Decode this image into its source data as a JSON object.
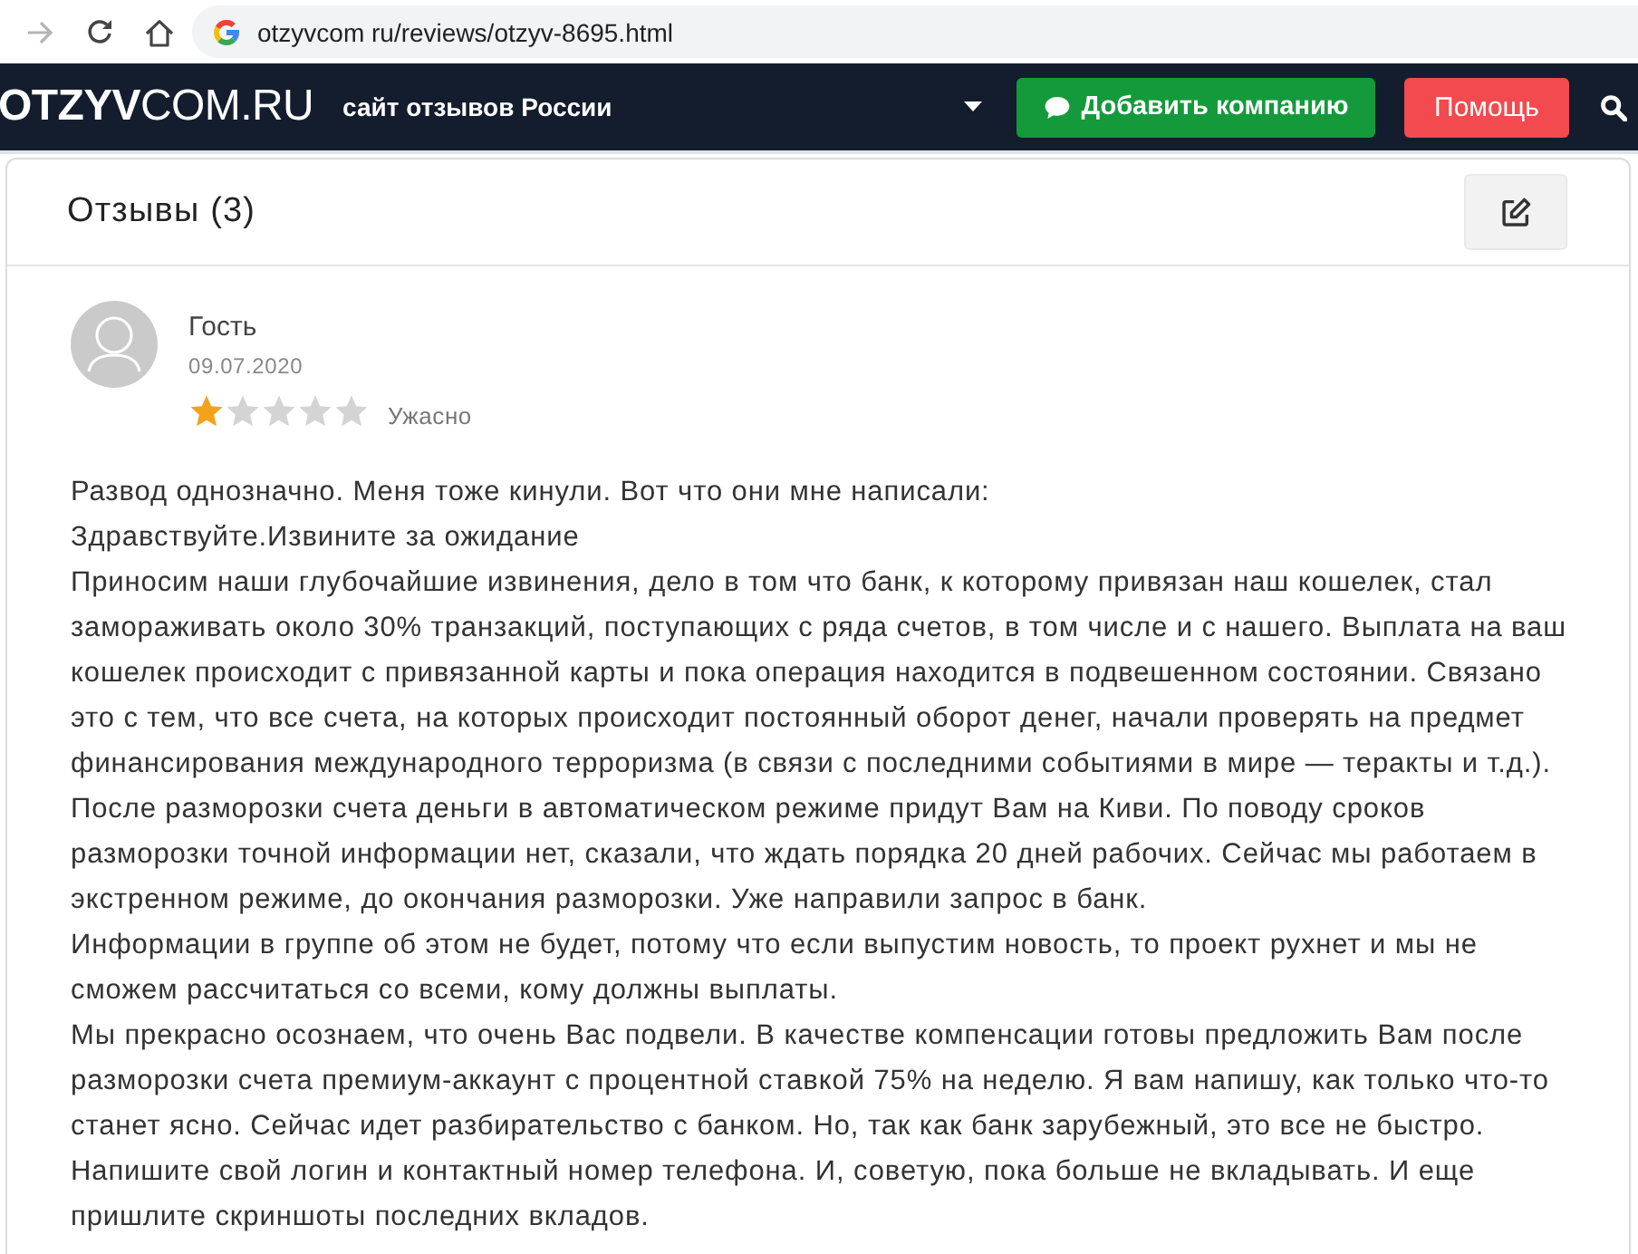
{
  "browser": {
    "nav_buttons": [
      {
        "kind": "forward",
        "disabled": true
      },
      {
        "kind": "reload",
        "disabled": false
      },
      {
        "kind": "home",
        "disabled": false
      }
    ],
    "url": "otzyvcom ru/reviews/otzyv-8695.html"
  },
  "site_header": {
    "logo": "**OTZYV**COM.RU",
    "tagline": "сайт отзывов России",
    "add_company_button": "Добавить компанию",
    "help_button": "Помощь"
  },
  "reviews_panel": {
    "title": "Отзывы (3)",
    "reviews": [
      {
        "author": "Гость",
        "date": "09.07.2020",
        "stars": 1,
        "rating_label": "Ужасно",
        "paragraphs": [
          "Развод однозначно. Меня тоже кинули. Вот что они мне написали:",
          "Здравствуйте.Извините за ожидание",
          "Приносим наши глубочайшие извинения, дело в том что банк, к которому привязан наш кошелек, стал замораживать около 30% транзакций, поступающих с ряда счетов, в том числе и с нашего. Выплата на ваш кошелек происходит с привязанной карты и пока операция находится в подвешенном состоянии. Связано это с тем, что все счета, на которых происходит постоянный оборот денег, начали проверять на предмет финансирования международного терроризма (в связи с последними событиями в мире — теракты и т.д.). После разморозки счета деньги в автоматическом режиме придут Вам на Киви. По поводу сроков",
          "разморозки точной информации нет, сказали, что ждать порядка 20 дней рабочих. Сейчас мы работаем в экстренном режиме, до окончания разморозки. Уже направили запрос в банк.",
          "Информации в группе об этом не будет, потому что если выпустим новость, то проект рухнет и мы не сможем рассчитаться со всеми, кому должны выплаты.",
          "Мы прекрасно осознаем, что очень Вас подвели. В качестве компенсации готовы предложить Вам после разморозки счета премиум-аккаунт с процентной ставкой 75% на неделю. Я вам напишу, как только что-то станет ясно. Сейчас идет разбирательство с банком. Но, так как банк зарубежный, это все не быстро. Напишите свой логин и контактный номер телефона. И, советую, пока больше не вкладывать. И еще пришлите скриншоты последних вкладов."
        ]
      }
    ]
  }
}
